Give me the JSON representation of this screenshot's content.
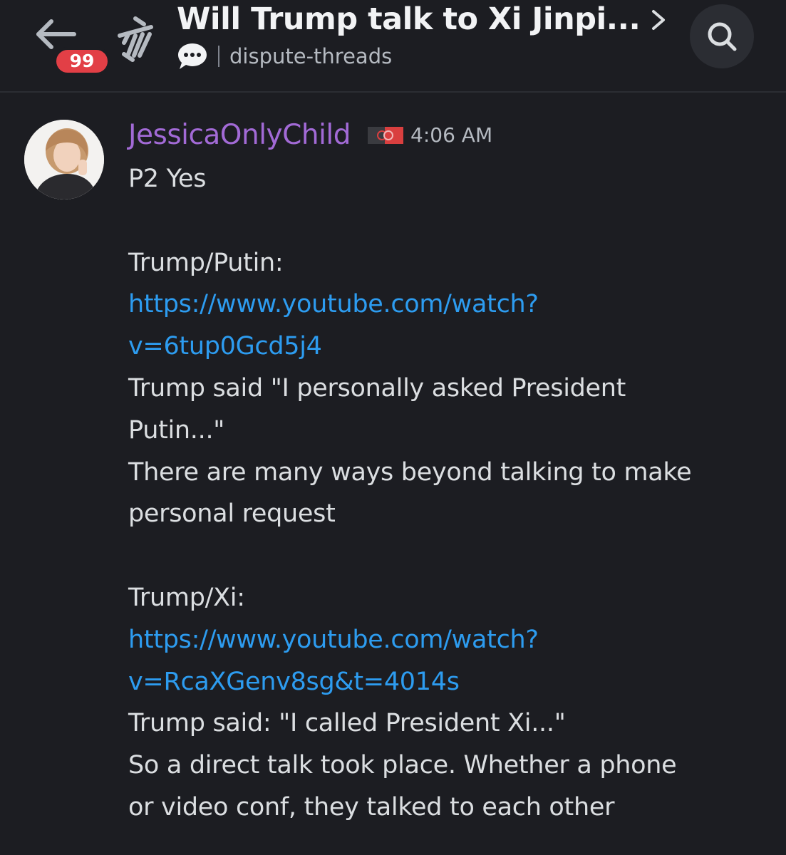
{
  "header": {
    "back_icon": "arrow-left-icon",
    "unread_badge": "99",
    "thread_icon": "thread-icon",
    "title": "Will Trump talk to Xi Jinpi...",
    "title_chevron_icon": "chevron-right-icon",
    "channel_icon": "speech-bubble-icon",
    "channel_name": "dispute-threads",
    "search_icon": "search-icon"
  },
  "message": {
    "username": "JessicaOnlyChild",
    "username_color": "#a26ad6",
    "timestamp": "4:06 AM",
    "lines": [
      {
        "text": "P2 Yes",
        "type": "text"
      },
      {
        "text": "",
        "type": "blank"
      },
      {
        "text": "Trump/Putin:",
        "type": "text"
      },
      {
        "text": "https://www.youtube.com/watch?",
        "type": "link"
      },
      {
        "text": "v=6tup0Gcd5j4",
        "type": "link"
      },
      {
        "text": "Trump said \"I personally asked President",
        "type": "text"
      },
      {
        "text": "Putin...\"",
        "type": "text"
      },
      {
        "text": "There are many ways beyond talking to make",
        "type": "text"
      },
      {
        "text": "personal request",
        "type": "text"
      },
      {
        "text": "",
        "type": "blank"
      },
      {
        "text": "Trump/Xi:",
        "type": "text"
      },
      {
        "text": "https://www.youtube.com/watch?",
        "type": "link"
      },
      {
        "text": "v=RcaXGenv8sg&t=4014s",
        "type": "link"
      },
      {
        "text": "Trump said: \"I called President Xi...\"",
        "type": "text"
      },
      {
        "text": "So a direct talk took place. Whether a phone",
        "type": "text"
      },
      {
        "text": "or video conf, they talked to each other",
        "type": "text"
      }
    ]
  },
  "colors": {
    "background": "#1c1d22",
    "link": "#2d9cf0",
    "badge": "#e23f46",
    "text": "#dbdee1",
    "muted": "#b5bac1"
  }
}
